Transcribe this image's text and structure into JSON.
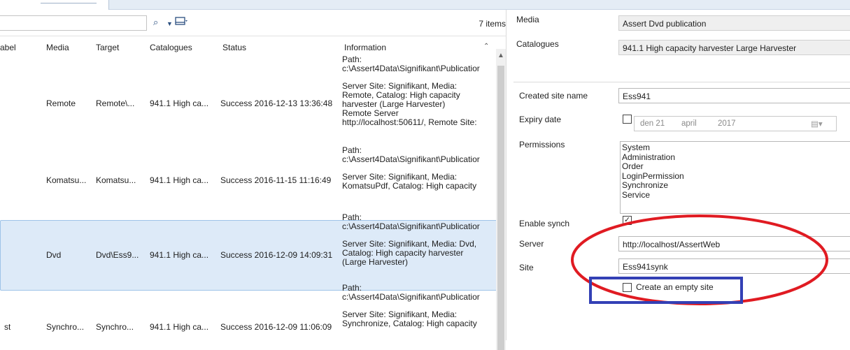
{
  "list": {
    "items_count": "7 items",
    "columns": [
      "abel",
      "Media",
      "Target",
      "Catalogues",
      "Status",
      "Information"
    ],
    "rows": [
      {
        "label": "",
        "media": "Remote",
        "target": "Remote\\...",
        "catalogues": "941.1 High ca...",
        "status": "Success 2016-12-13 13:36:48",
        "info": "Path:\nc:\\Assert4Data\\Signifikant\\Publicatior\n\nServer Site: Signifikant, Media:\nRemote, Catalog: High capacity\nharvester (Large Harvester)\nRemote Server\nhttp://localhost:50611/, Remote Site:"
      },
      {
        "label": "",
        "media": "Komatsu...",
        "target": "Komatsu...",
        "catalogues": "941.1 High ca...",
        "status": "Success 2016-11-15 11:16:49",
        "info": "Path:\nc:\\Assert4Data\\Signifikant\\Publicatior\n\nServer Site: Signifikant, Media:\nKomatsuPdf, Catalog: High capacity"
      },
      {
        "label": "",
        "media": "Dvd",
        "target": "Dvd\\Ess9...",
        "catalogues": "941.1 High ca...",
        "status": "Success 2016-12-09 14:09:31",
        "info": "Path:\nc:\\Assert4Data\\Signifikant\\Publicatior\n\nServer Site: Signifikant, Media: Dvd,\nCatalog: High capacity harvester\n(Large Harvester)"
      },
      {
        "label": "st",
        "media": "Synchro...",
        "target": "Synchro...",
        "catalogues": "941.1 High ca...",
        "status": "Success 2016-12-09 11:06:09",
        "info": "Path:\nc:\\Assert4Data\\Signifikant\\Publicatior\n\nServer Site: Signifikant, Media:\nSynchronize, Catalog: High capacity"
      }
    ]
  },
  "details": {
    "media_label": "Media",
    "media_value": "Assert Dvd publication",
    "catalogues_label": "Catalogues",
    "catalogues_value": "941.1 High capacity harvester Large Harvester",
    "created_site_label": "Created site name",
    "created_site_value": "Ess941",
    "expiry_label": "Expiry date",
    "expiry_checked": false,
    "expiry_day": "den 21",
    "expiry_month": "april",
    "expiry_year": "2017",
    "permissions_label": "Permissions",
    "permissions": [
      "System",
      "Administration",
      "Order",
      "LoginPermission",
      "Synchronize",
      "Service"
    ],
    "enable_synch_label": "Enable synch",
    "enable_synch_checked": true,
    "server_label": "Server",
    "server_value": "http://localhost/AssertWeb",
    "site_label": "Site",
    "site_value": "Ess941synk",
    "create_empty_label": "Create an empty site",
    "create_empty_checked": false
  },
  "colors": {
    "highlight_ellipse": "#e01b22",
    "highlight_box": "#3340b5",
    "selected_row": "#ddeaf8"
  }
}
